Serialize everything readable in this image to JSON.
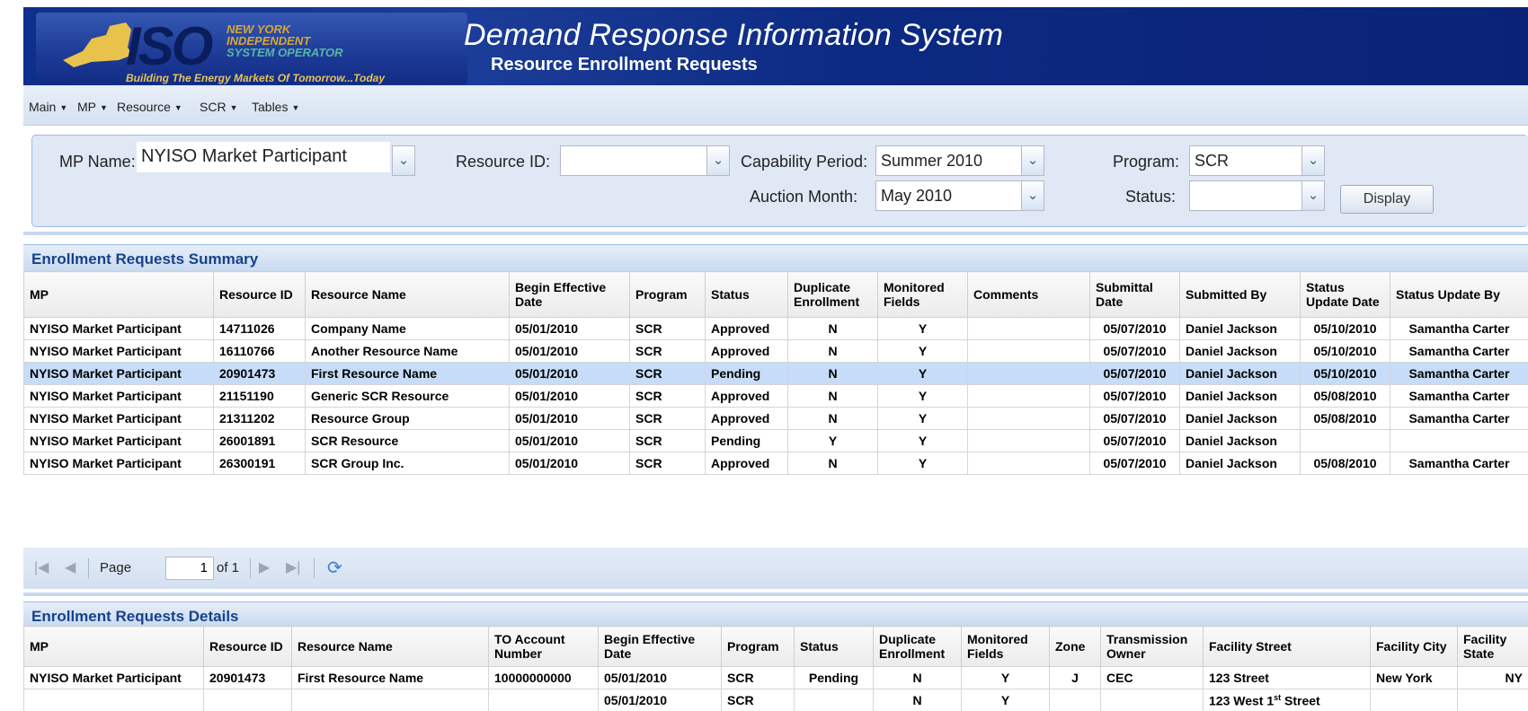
{
  "header": {
    "logo_big": "ISO",
    "logo_lines": [
      "NEW YORK",
      "INDEPENDENT",
      "SYSTEM OPERATOR"
    ],
    "logo_tagline": "Building The Energy Markets Of Tomorrow...Today",
    "title": "Demand Response Information System",
    "subtitle": "Resource Enrollment Requests"
  },
  "menu": [
    "Main",
    "MP",
    "Resource",
    "SCR",
    "Tables"
  ],
  "filters": {
    "mp_name_label": "MP Name:",
    "mp_name_value": "NYISO Market Participant",
    "resource_id_label": "Resource ID:",
    "resource_id_value": "",
    "capability_period_label": "Capability Period:",
    "capability_period_value": "Summer 2010",
    "program_label": "Program:",
    "program_value": "SCR",
    "auction_month_label": "Auction Month:",
    "auction_month_value": "May 2010",
    "status_label": "Status:",
    "status_value": "",
    "display_button": "Display"
  },
  "summary": {
    "title": "Enrollment Requests Summary",
    "columns": [
      "MP",
      "Resource ID",
      "Resource Name",
      "Begin Effective Date",
      "Program",
      "Status",
      "Duplicate Enrollment",
      "Monitored Fields",
      "Comments",
      "Submittal Date",
      "Submitted By",
      "Status Update Date",
      "Status Update By"
    ],
    "rows": [
      [
        "NYISO Market Participant",
        "14711026",
        "Company Name",
        "05/01/2010",
        "SCR",
        "Approved",
        "N",
        "Y",
        "",
        "05/07/2010",
        "Daniel Jackson",
        "05/10/2010",
        "Samantha Carter"
      ],
      [
        "NYISO Market Participant",
        "16110766",
        "Another Resource Name",
        "05/01/2010",
        "SCR",
        "Approved",
        "N",
        "Y",
        "",
        "05/07/2010",
        "Daniel Jackson",
        "05/10/2010",
        "Samantha Carter"
      ],
      [
        "NYISO Market Participant",
        "20901473",
        "First Resource Name",
        "05/01/2010",
        "SCR",
        "Pending",
        "N",
        "Y",
        "",
        "05/07/2010",
        "Daniel Jackson",
        "05/10/2010",
        "Samantha Carter"
      ],
      [
        "NYISO Market Participant",
        "21151190",
        "Generic SCR Resource",
        "05/01/2010",
        "SCR",
        "Approved",
        "N",
        "Y",
        "",
        "05/07/2010",
        "Daniel Jackson",
        "05/08/2010",
        "Samantha Carter"
      ],
      [
        "NYISO Market Participant",
        "21311202",
        "Resource Group",
        "05/01/2010",
        "SCR",
        "Approved",
        "N",
        "Y",
        "",
        "05/07/2010",
        "Daniel Jackson",
        "05/08/2010",
        "Samantha Carter"
      ],
      [
        "NYISO Market Participant",
        "26001891",
        "SCR Resource",
        "05/01/2010",
        "SCR",
        "Pending",
        "Y",
        "Y",
        "",
        "05/07/2010",
        "Daniel Jackson",
        "",
        ""
      ],
      [
        "NYISO Market Participant",
        "26300191",
        "SCR Group Inc.",
        "05/01/2010",
        "SCR",
        "Approved",
        "N",
        "Y",
        "",
        "05/07/2010",
        "Daniel Jackson",
        "05/08/2010",
        "Samantha Carter"
      ]
    ]
  },
  "pager": {
    "page_label": "Page",
    "page_value": "1",
    "of_label": "of 1"
  },
  "details": {
    "title": "Enrollment Requests Details",
    "columns": [
      "MP",
      "Resource ID",
      "Resource Name",
      "TO Account Number",
      "Begin Effective Date",
      "Program",
      "Status",
      "Duplicate Enrollment",
      "Monitored Fields",
      "Zone",
      "Transmission Owner",
      "Facility Street",
      "Facility City",
      "Facility State"
    ],
    "rows": [
      [
        "NYISO Market Participant",
        "20901473",
        "First Resource Name",
        "10000000000",
        "05/01/2010",
        "SCR",
        "Pending",
        "N",
        "Y",
        "J",
        "CEC",
        "123 Street",
        "New York",
        "NY"
      ],
      [
        "",
        "",
        "",
        "",
        "05/01/2010",
        "SCR",
        "",
        "N",
        "Y",
        "",
        "",
        "123 West 1st Street",
        "",
        ""
      ]
    ]
  }
}
